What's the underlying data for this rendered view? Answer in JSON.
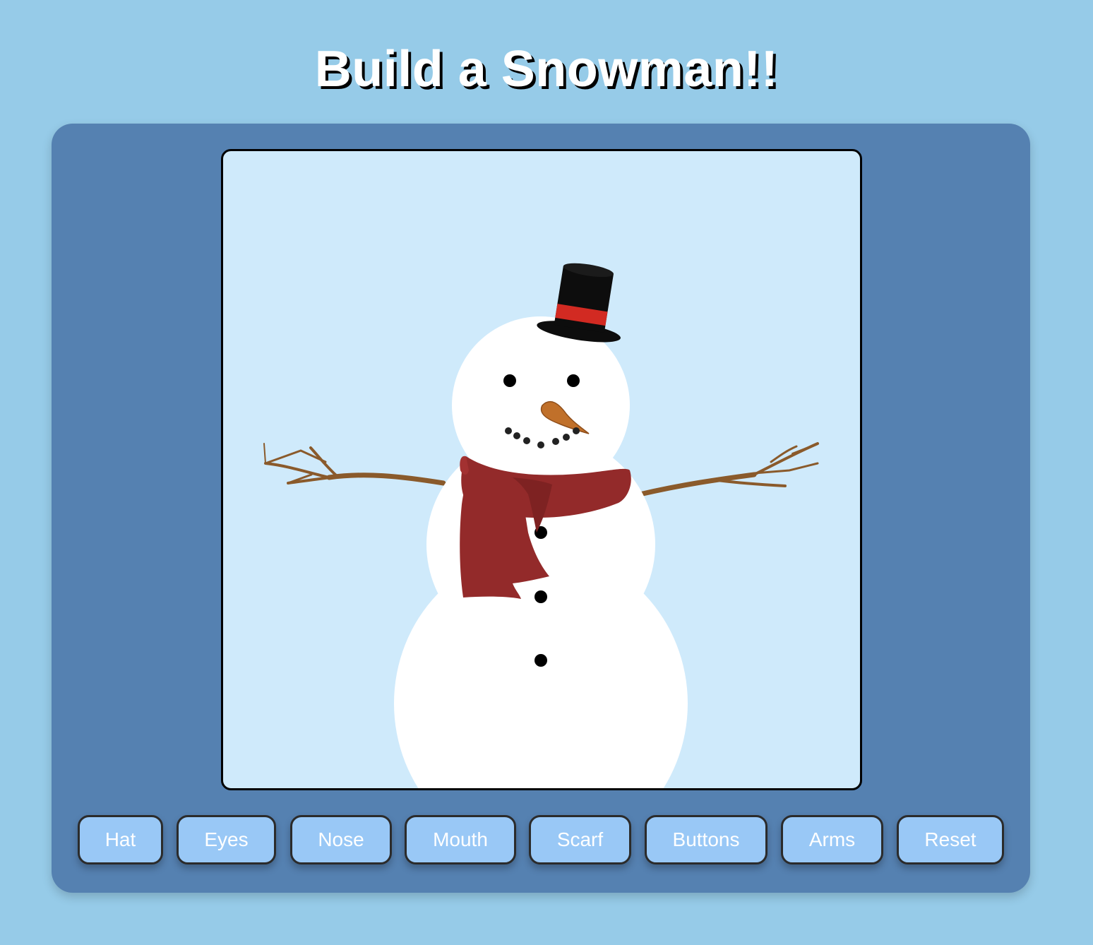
{
  "title": "Build a Snowman!!",
  "buttons": {
    "hat": "Hat",
    "eyes": "Eyes",
    "nose": "Nose",
    "mouth": "Mouth",
    "scarf": "Scarf",
    "buttons": "Buttons",
    "arms": "Arms",
    "reset": "Reset"
  },
  "colors": {
    "page_background": "#96cbe8",
    "panel": "#5581b1",
    "stage": "#cfeafb",
    "button_fill": "#99c8f6",
    "snow": "#ffffff",
    "hat": "#0d0d0d",
    "hat_band": "#d22a22",
    "scarf": "#932a2a",
    "nose": "#c0702a",
    "arms": "#8a5a2b"
  }
}
